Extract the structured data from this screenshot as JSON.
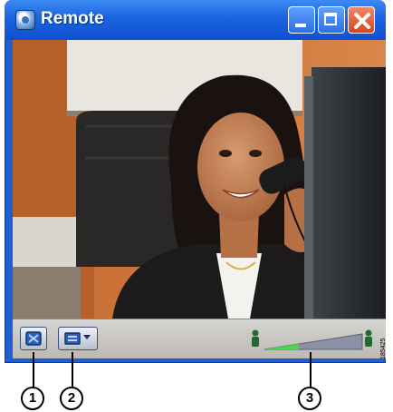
{
  "window": {
    "title": "Remote",
    "accent": "#1f5fd6",
    "close_color": "#d8431b"
  },
  "titlebar_buttons": {
    "minimize_icon": "minimize-icon",
    "maximize_icon": "maximize-icon",
    "close_icon": "close-icon"
  },
  "controlbar": {
    "view_button_icon": "view-toggle-icon",
    "menu_button_icon": "menu-dropdown-icon",
    "volume_left_icon": "person-icon",
    "volume_right_icon": "person-icon",
    "volume_level": 0.35
  },
  "callouts": [
    "1",
    "2",
    "3"
  ],
  "side_id": "185425"
}
